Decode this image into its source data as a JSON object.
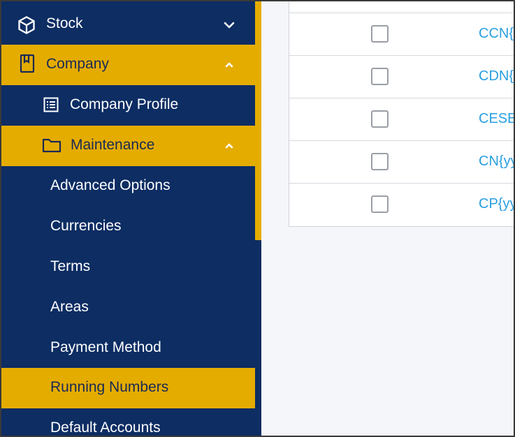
{
  "sidebar": {
    "stock": {
      "label": "Stock",
      "icon": "box-icon"
    },
    "company": {
      "label": "Company",
      "icon": "book-icon"
    },
    "company_profile": {
      "label": "Company Profile",
      "icon": "list-icon"
    },
    "maintenance": {
      "label": "Maintenance",
      "icon": "folder-icon"
    },
    "sub_items": [
      {
        "label": "Advanced Options"
      },
      {
        "label": "Currencies"
      },
      {
        "label": "Terms"
      },
      {
        "label": "Areas"
      },
      {
        "label": "Payment Method"
      },
      {
        "label": "Running Numbers",
        "active": true
      },
      {
        "label": "Default Accounts"
      }
    ]
  },
  "table": {
    "rows": [
      {
        "code": "CCN{"
      },
      {
        "code": "CDN{"
      },
      {
        "code": "CESB-"
      },
      {
        "code": "CN{yy"
      },
      {
        "code": "CP{yy"
      }
    ]
  },
  "colors": {
    "sidebar_bg": "#0d2d63",
    "accent_gold": "#e5ac00",
    "link_blue": "#2a9fe0",
    "content_bg": "#f5f6fa"
  }
}
